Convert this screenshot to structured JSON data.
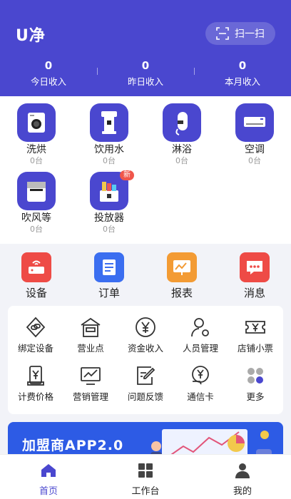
{
  "header": {
    "logo": "U净",
    "scan_label": "扫一扫",
    "stats": [
      {
        "value": "0",
        "label": "今日收入"
      },
      {
        "value": "0",
        "label": "昨日收入"
      },
      {
        "value": "0",
        "label": "本月收入"
      }
    ]
  },
  "devices": [
    {
      "name": "洗烘",
      "count": "0台",
      "icon": "washing-machine-icon"
    },
    {
      "name": "饮用水",
      "count": "0台",
      "icon": "water-dispenser-icon"
    },
    {
      "name": "淋浴",
      "count": "0台",
      "icon": "water-heater-icon"
    },
    {
      "name": "空调",
      "count": "0台",
      "icon": "air-conditioner-icon"
    },
    {
      "name": "吹风等",
      "count": "0台",
      "icon": "hair-dryer-icon"
    },
    {
      "name": "投放器",
      "count": "0台",
      "icon": "dispenser-icon",
      "badge": "新"
    }
  ],
  "quick": [
    {
      "label": "设备",
      "icon": "router-icon",
      "color": "#ee4b46"
    },
    {
      "label": "订单",
      "icon": "order-icon",
      "color": "#3b6ef0"
    },
    {
      "label": "报表",
      "icon": "report-icon",
      "color": "#f39b34"
    },
    {
      "label": "消息",
      "icon": "message-icon",
      "color": "#ee4b46"
    }
  ],
  "tools": [
    {
      "label": "绑定设备",
      "icon": "link-icon"
    },
    {
      "label": "营业点",
      "icon": "store-icon"
    },
    {
      "label": "资金收入",
      "icon": "yen-coin-icon"
    },
    {
      "label": "人员管理",
      "icon": "user-settings-icon"
    },
    {
      "label": "店铺小票",
      "icon": "ticket-icon"
    },
    {
      "label": "计费价格",
      "icon": "price-tag-icon"
    },
    {
      "label": "营销管理",
      "icon": "chart-monitor-icon"
    },
    {
      "label": "问题反馈",
      "icon": "feedback-icon"
    },
    {
      "label": "通信卡",
      "icon": "sim-card-icon"
    },
    {
      "label": "更多",
      "icon": "more-grid-icon"
    }
  ],
  "banner": {
    "text": "加盟商APP2.0"
  },
  "tabbar": [
    {
      "label": "首页",
      "icon": "home-icon",
      "active": true
    },
    {
      "label": "工作台",
      "icon": "workbench-icon",
      "active": false
    },
    {
      "label": "我的",
      "icon": "profile-icon",
      "active": false
    }
  ],
  "colors": {
    "primary": "#4a47cf",
    "badge": "#f0564b"
  }
}
